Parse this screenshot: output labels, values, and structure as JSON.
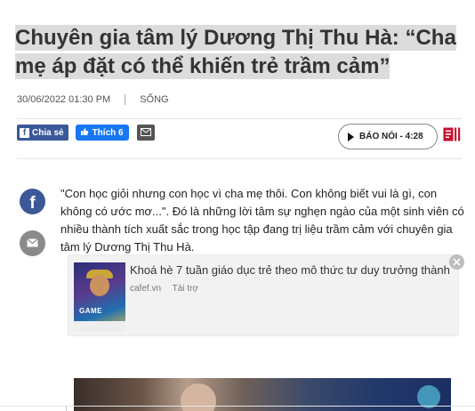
{
  "article": {
    "title": "Chuyên gia tâm lý Dương Thị Thu Hà: “Cha mẹ áp đặt có thể khiến trẻ trầm cảm”",
    "datetime": "30/06/2022 01:30 PM",
    "category": "SỐNG",
    "lead": "\"Con học giỏi nhưng con học vì cha mẹ thôi. Con không biết vui là gì, con không có ước mơ...\". Đó là những lời tâm sự nghẹn ngào của một sinh viên có nhiều thành tích xuất sắc trong học tập đang trị liệu trầm cảm với chuyên gia tâm lý Dương Thị Thu Hà."
  },
  "share": {
    "fb_share_label": "Chia sẻ",
    "like_label": "Thích 6",
    "audio_label": "BÁO NÓI - 4:28"
  },
  "ad": {
    "title": "Khoá hè 7 tuần giáo dục trẻ theo mô thức tư duy trưởng thành",
    "source": "cafef.vn",
    "sponsored": "Tài trợ",
    "thumb_text": "GAME"
  },
  "colors": {
    "facebook": "#3b5998",
    "like": "#1877f2",
    "comment_icon": "#c8102e"
  },
  "icons": [
    "facebook-icon",
    "thumbs-up-icon",
    "mail-icon",
    "play-icon",
    "comment-icon",
    "close-icon"
  ]
}
